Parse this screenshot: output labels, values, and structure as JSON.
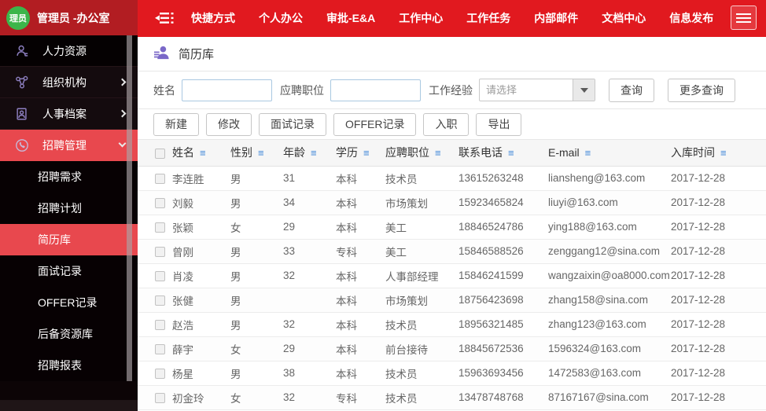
{
  "topbar": {
    "avatar_text": "理员",
    "user": "管理员 -办公室",
    "nav": [
      "快捷方式",
      "个人办公",
      "审批-E&A",
      "工作中心",
      "工作任务",
      "内部邮件",
      "文档中心",
      "信息发布"
    ]
  },
  "sidebar": {
    "items": [
      {
        "label": "人力资源",
        "icon": "person-icon",
        "chevron": null,
        "active": false
      },
      {
        "label": "组织机构",
        "icon": "org-icon",
        "chevron": "right",
        "active": false
      },
      {
        "label": "人事档案",
        "icon": "archive-icon",
        "chevron": "right",
        "active": false
      },
      {
        "label": "招聘管理",
        "icon": "recruit-icon",
        "chevron": "down",
        "active": true
      }
    ],
    "submenu": [
      {
        "label": "招聘需求",
        "active": false
      },
      {
        "label": "招聘计划",
        "active": false
      },
      {
        "label": "简历库",
        "active": true
      },
      {
        "label": "面试记录",
        "active": false
      },
      {
        "label": "OFFER记录",
        "active": false
      },
      {
        "label": "后备资源库",
        "active": false
      },
      {
        "label": "招聘报表",
        "active": false
      }
    ]
  },
  "page": {
    "title": "简历库",
    "search": {
      "name_label": "姓名",
      "position_label": "应聘职位",
      "experience_label": "工作经验",
      "experience_placeholder": "请选择",
      "search_button": "查询",
      "more_button": "更多查询"
    },
    "actions": [
      "新建",
      "修改",
      "面试记录",
      "OFFER记录",
      "入职",
      "导出"
    ],
    "table": {
      "columns": [
        "姓名",
        "性别",
        "年龄",
        "学历",
        "应聘职位",
        "联系电话",
        "E-mail",
        "入库时间"
      ],
      "rows": [
        [
          "李连胜",
          "男",
          "31",
          "本科",
          "技术员",
          "13615263248",
          "liansheng@163.com",
          "2017-12-28"
        ],
        [
          "刘毅",
          "男",
          "34",
          "本科",
          "市场策划",
          "15923465824",
          "liuyi@163.com",
          "2017-12-28"
        ],
        [
          "张颖",
          "女",
          "29",
          "本科",
          "美工",
          "18846524786",
          "ying188@163.com",
          "2017-12-28"
        ],
        [
          "曾刚",
          "男",
          "33",
          "专科",
          "美工",
          "15846588526",
          "zenggang12@sina.com",
          "2017-12-28"
        ],
        [
          "肖凌",
          "男",
          "32",
          "本科",
          "人事部经理",
          "15846241599",
          "wangzaixin@oa8000.com",
          "2017-12-28"
        ],
        [
          "张健",
          "男",
          "",
          "本科",
          "市场策划",
          "18756423698",
          "zhang158@sina.com",
          "2017-12-28"
        ],
        [
          "赵浩",
          "男",
          "32",
          "本科",
          "技术员",
          "18956321485",
          "zhang123@163.com",
          "2017-12-28"
        ],
        [
          "薛宇",
          "女",
          "29",
          "本科",
          "前台接待",
          "18845672536",
          "1596324@163.com",
          "2017-12-28"
        ],
        [
          "杨星",
          "男",
          "38",
          "本科",
          "技术员",
          "15963693456",
          "1472583@163.com",
          "2017-12-28"
        ],
        [
          "初金玲",
          "女",
          "32",
          "专科",
          "技术员",
          "13478748768",
          "87167167@sina.com",
          "2017-12-28"
        ]
      ]
    }
  },
  "colors": {
    "topbar_red": "#e1191f",
    "topbar_user_red": "#b21d22",
    "active_red": "#e8484e",
    "sidebar_bg": "#0c0406",
    "avatar_green": "#3cb54a",
    "sort_icon_blue": "#3d85d8",
    "icon_purple": "#8d7fc0",
    "input_border_blue": "#a9c8e1"
  }
}
